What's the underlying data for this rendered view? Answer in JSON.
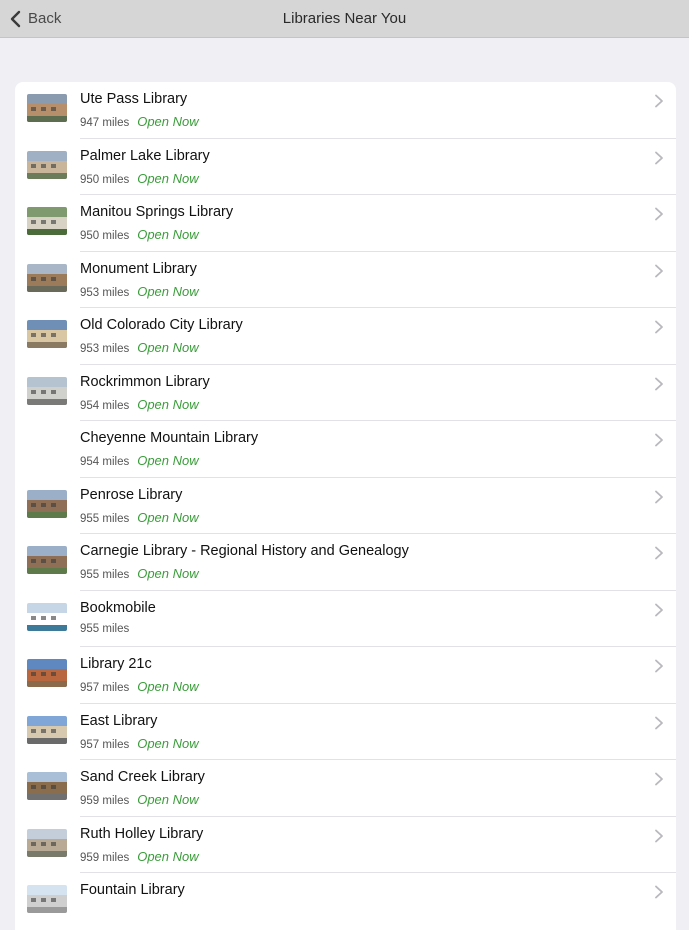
{
  "navbar": {
    "back_label": "Back",
    "title": "Libraries Near You",
    "back_icon": "chevron-left-icon"
  },
  "colors": {
    "open_now": "#3a9c3a",
    "navbar_bg": "#d6d6d6",
    "page_bg": "#f0eff4"
  },
  "libraries": [
    {
      "name": "Ute Pass Library",
      "distance": "947 miles",
      "status": "Open Now",
      "thumb": "building-photo"
    },
    {
      "name": "Palmer Lake Library",
      "distance": "950 miles",
      "status": "Open Now",
      "thumb": "building-photo"
    },
    {
      "name": "Manitou Springs Library",
      "distance": "950 miles",
      "status": "Open Now",
      "thumb": "building-photo"
    },
    {
      "name": "Monument Library",
      "distance": "953 miles",
      "status": "Open Now",
      "thumb": "building-photo"
    },
    {
      "name": "Old Colorado City Library",
      "distance": "953 miles",
      "status": "Open Now",
      "thumb": "building-photo"
    },
    {
      "name": "Rockrimmon Library",
      "distance": "954 miles",
      "status": "Open Now",
      "thumb": "building-photo"
    },
    {
      "name": "Cheyenne Mountain Library",
      "distance": "954 miles",
      "status": "Open Now",
      "thumb": ""
    },
    {
      "name": "Penrose Library",
      "distance": "955 miles",
      "status": "Open Now",
      "thumb": "building-photo"
    },
    {
      "name": "Carnegie Library - Regional History and Genealogy",
      "distance": "955 miles",
      "status": "Open Now",
      "thumb": "building-photo"
    },
    {
      "name": "Bookmobile",
      "distance": "955 miles",
      "status": "",
      "thumb": "bus-photo"
    },
    {
      "name": "Library 21c",
      "distance": "957 miles",
      "status": "Open Now",
      "thumb": "building-photo"
    },
    {
      "name": "East Library",
      "distance": "957 miles",
      "status": "Open Now",
      "thumb": "building-photo"
    },
    {
      "name": "Sand Creek Library",
      "distance": "959 miles",
      "status": "Open Now",
      "thumb": "building-photo"
    },
    {
      "name": "Ruth Holley Library",
      "distance": "959 miles",
      "status": "Open Now",
      "thumb": "building-photo"
    },
    {
      "name": "Fountain Library",
      "distance": "",
      "status": "",
      "thumb": "building-photo"
    }
  ]
}
